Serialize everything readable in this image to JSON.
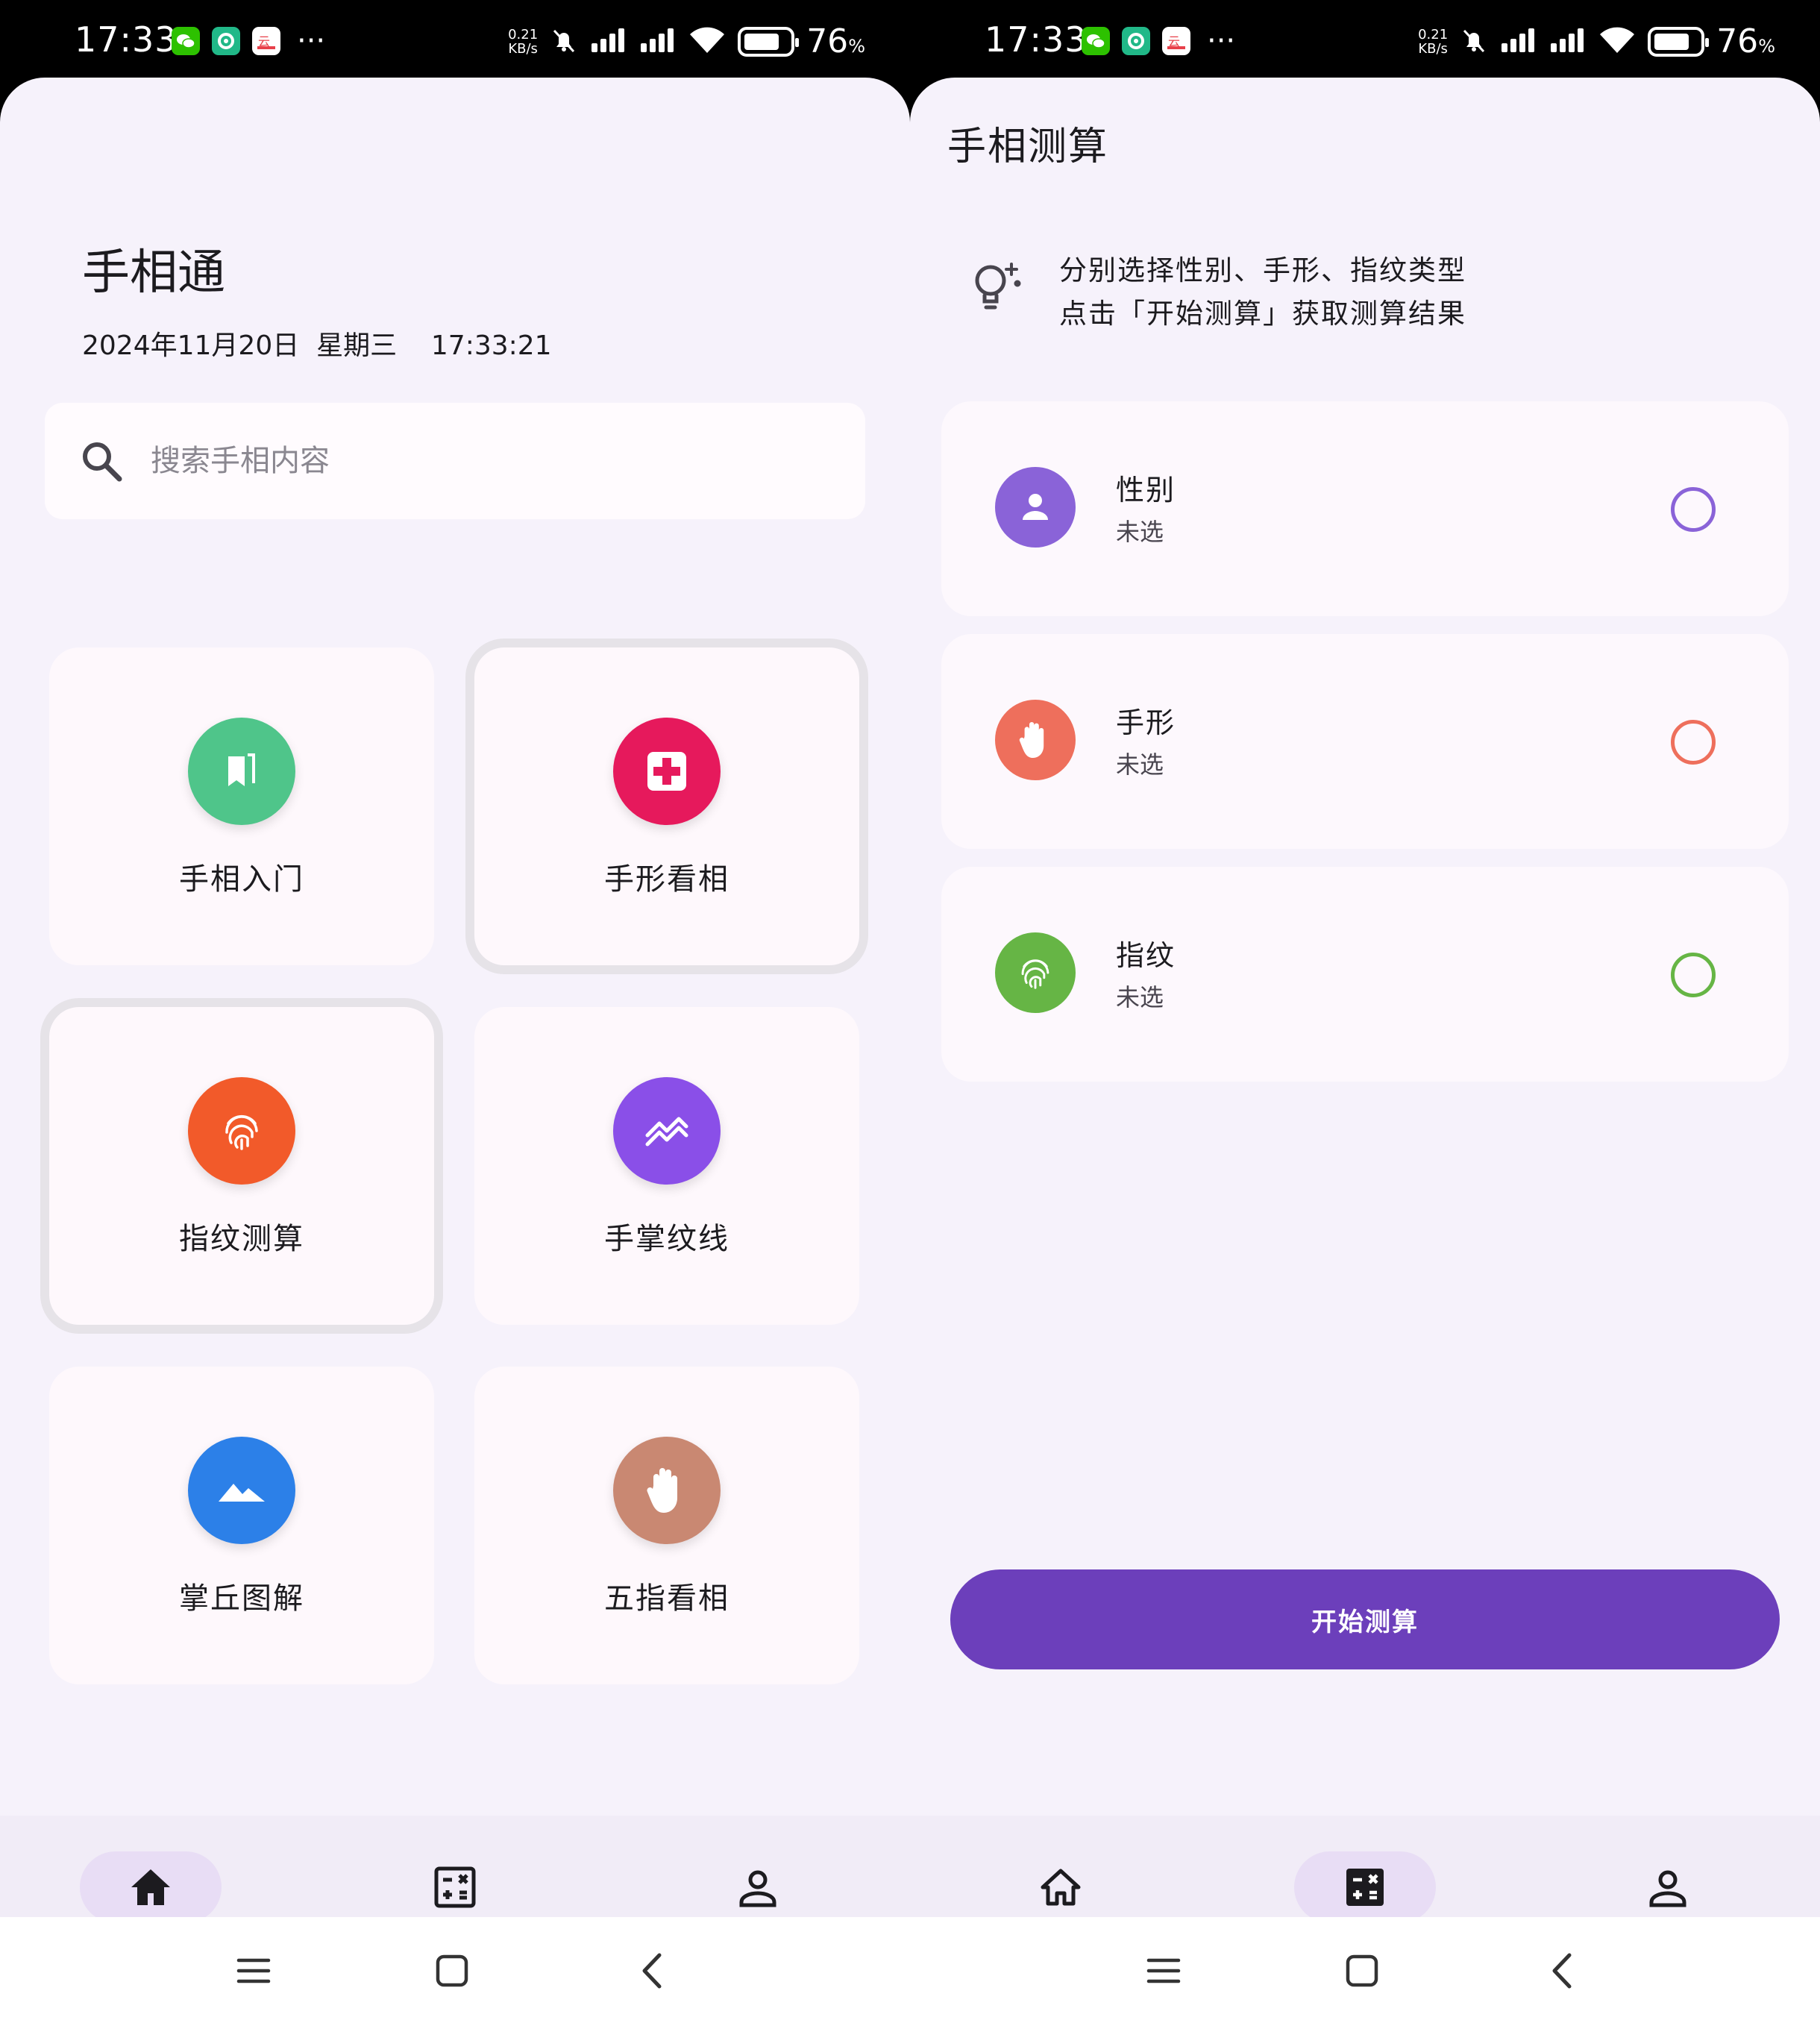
{
  "status_bar": {
    "time": "17:33",
    "speed_value": "0.21",
    "speed_unit": "KB/s",
    "battery_pct": "76",
    "battery_unit": "%"
  },
  "home": {
    "title": "手相通",
    "datetime": "2024年11月20日  星期三    17:33:21",
    "search_placeholder": "搜索手相内容",
    "tiles": [
      {
        "label": "手相入门",
        "icon": "book-icon",
        "color": "#4fc58a"
      },
      {
        "label": "手形看相",
        "icon": "hospital-icon",
        "color": "#e6195c"
      },
      {
        "label": "指纹测算",
        "icon": "fingerprint-icon",
        "color": "#f25a2a"
      },
      {
        "label": "手掌纹线",
        "icon": "lines-icon",
        "color": "#8a4fe8"
      },
      {
        "label": "掌丘图解",
        "icon": "mountain-icon",
        "color": "#2c80e8"
      },
      {
        "label": "五指看相",
        "icon": "hand-icon",
        "color": "#c98872"
      }
    ]
  },
  "calc": {
    "title": "手相测算",
    "tip_line1": "分别选择性别、手形、指纹类型",
    "tip_line2": "点击「开始测算」获取测算结果",
    "options": [
      {
        "name": "性别",
        "value": "未选",
        "color": "#8a63d8"
      },
      {
        "name": "手形",
        "value": "未选",
        "color": "#ee6f5c"
      },
      {
        "name": "指纹",
        "value": "未选",
        "color": "#66b545"
      }
    ],
    "start_label": "开始测算"
  },
  "nav": {
    "home": "主页",
    "calc": "测算",
    "mine": "我的"
  }
}
